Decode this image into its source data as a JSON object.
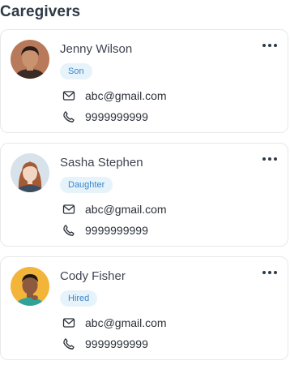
{
  "header": {
    "title": "Caregivers"
  },
  "caregivers": [
    {
      "name": "Jenny Wilson",
      "relation": "Son",
      "email": "abc@gmail.com",
      "phone": "9999999999",
      "avatar_bg": "#b87a5a",
      "skin": "#c9936f",
      "hair": "#2b1d16",
      "shirt": "#3b2b27"
    },
    {
      "name": "Sasha Stephen",
      "relation": "Daughter",
      "email": "abc@gmail.com",
      "phone": "9999999999",
      "avatar_bg": "#d8e2ea",
      "skin": "#f2d6c4",
      "hair": "#a55a36",
      "shirt": "#3c4f62"
    },
    {
      "name": "Cody Fisher",
      "relation": "Hired",
      "email": "abc@gmail.com",
      "phone": "9999999999",
      "avatar_bg": "#f2b53a",
      "skin": "#8d5a3f",
      "hair": "#1e1612",
      "shirt": "#2fa39a"
    }
  ],
  "icons": {
    "more": "more-horizontal-icon",
    "email": "mail-icon",
    "phone": "phone-icon"
  },
  "colors": {
    "tag_bg": "#e7f3fb",
    "tag_text": "#3a86c8",
    "border": "#e6e8eb"
  }
}
